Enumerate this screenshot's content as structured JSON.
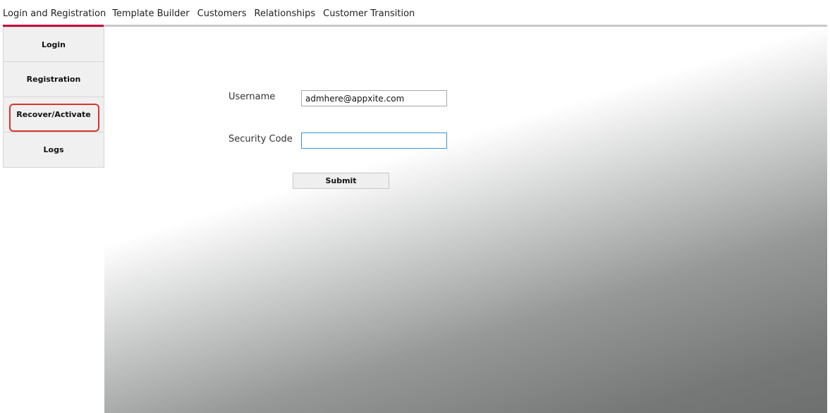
{
  "tabs": [
    {
      "label": "Login and Registration",
      "active": true
    },
    {
      "label": "Template Builder"
    },
    {
      "label": "Customers"
    },
    {
      "label": "Relationships"
    },
    {
      "label": "Customer Transition"
    }
  ],
  "sidebar": {
    "items": [
      {
        "label": "Login"
      },
      {
        "label": "Registration"
      },
      {
        "label": "Recover/Activate",
        "selected": true
      },
      {
        "label": "Logs"
      }
    ]
  },
  "form": {
    "username_label": "Username",
    "username_value": "admhere@appxite.com",
    "security_code_label": "Security Code",
    "security_code_value": "",
    "submit_label": "Submit"
  },
  "colors": {
    "active_tab_accent": "#c0103c",
    "selection_highlight": "#d9342b",
    "focus_border": "#3a97c6"
  }
}
